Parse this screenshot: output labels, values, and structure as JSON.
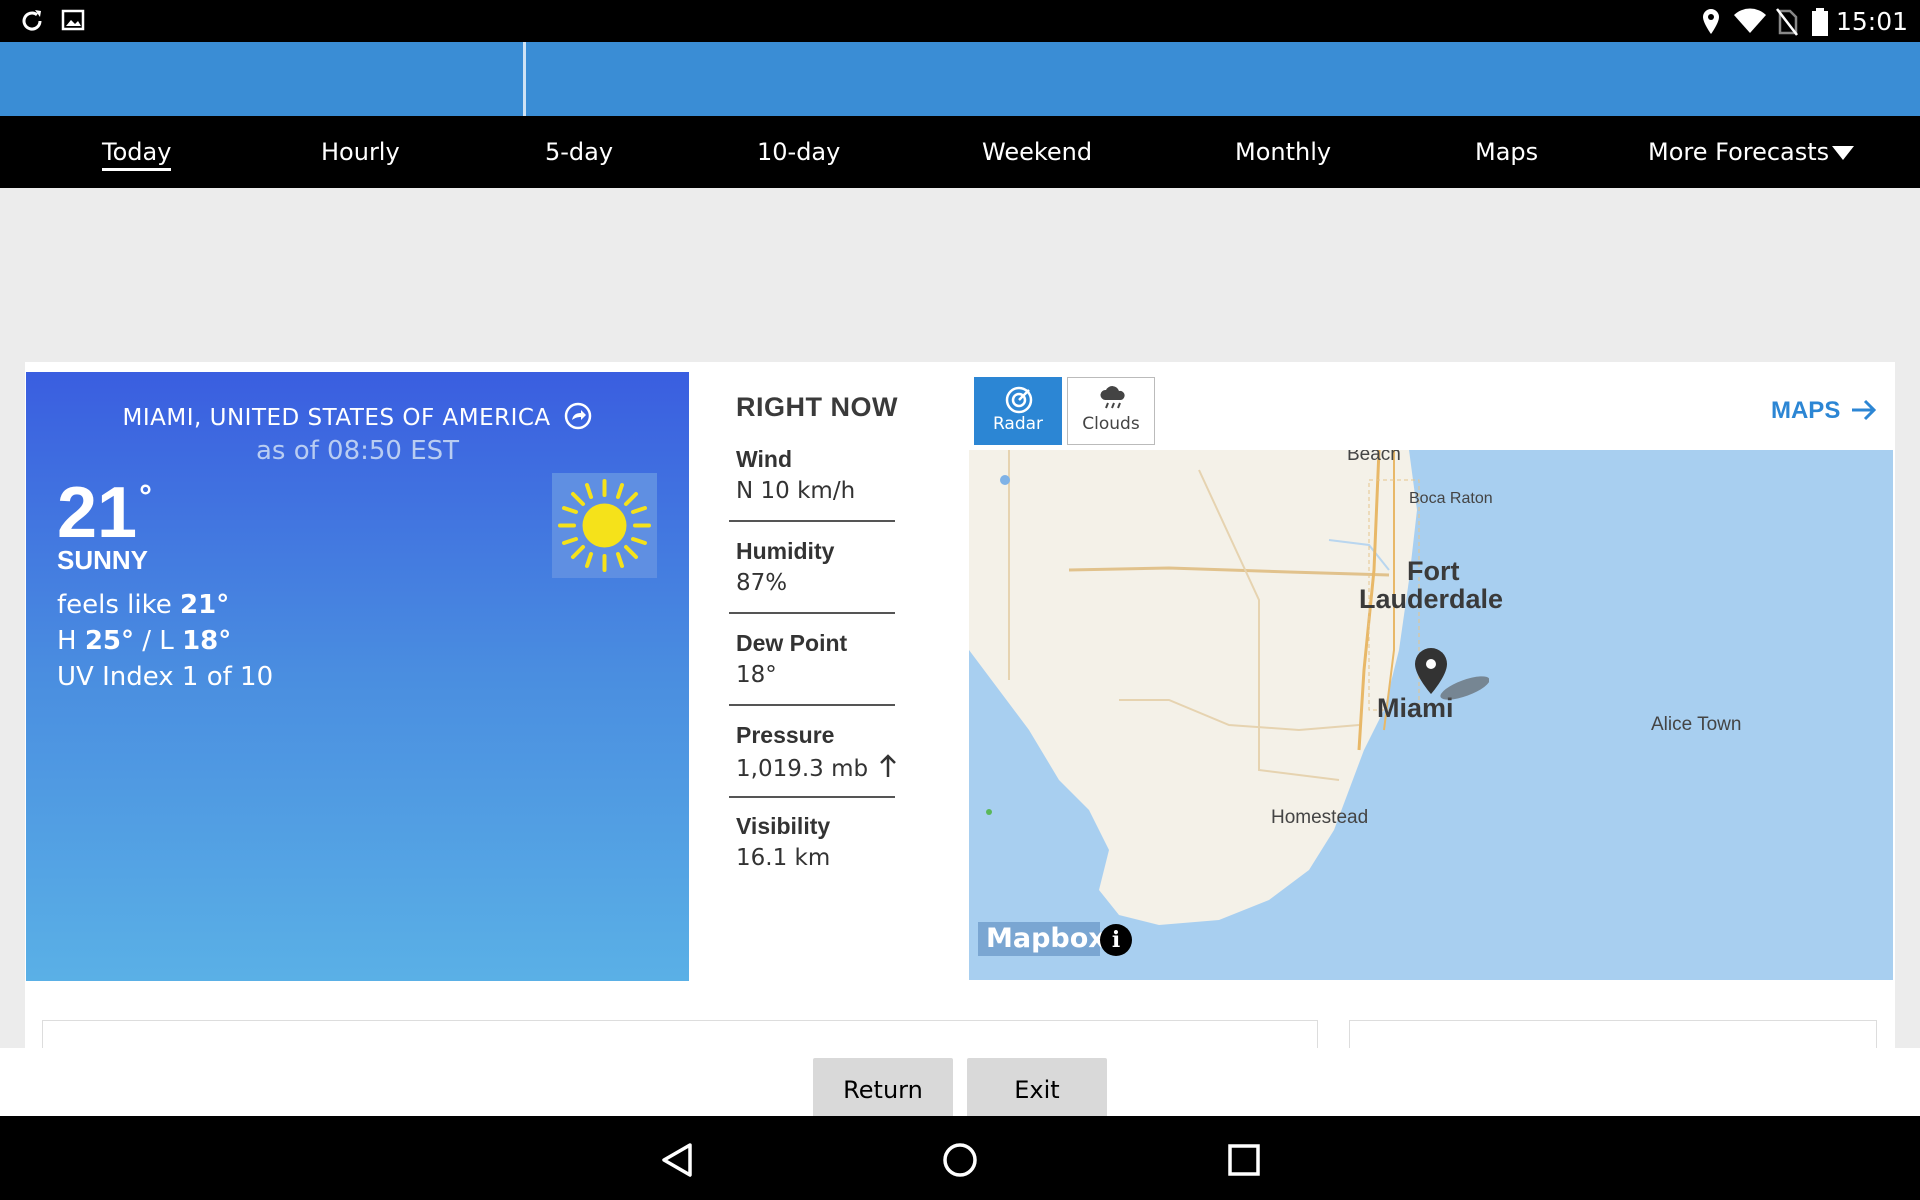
{
  "status_bar": {
    "time": "15:01",
    "icons": [
      "sync-icon",
      "image-icon",
      "location-icon",
      "wifi-icon",
      "no-sim-icon",
      "battery-icon"
    ]
  },
  "nav": {
    "tabs": [
      {
        "label": "Today",
        "active": true
      },
      {
        "label": "Hourly"
      },
      {
        "label": "5-day"
      },
      {
        "label": "10-day"
      },
      {
        "label": "Weekend"
      },
      {
        "label": "Monthly"
      },
      {
        "label": "Maps"
      },
      {
        "label": "More Forecasts"
      }
    ]
  },
  "current": {
    "location": "MIAMI, UNITED STATES OF AMERICA",
    "as_of": "as of 08:50 EST",
    "temp": "21",
    "degree": "°",
    "condition": "SUNNY",
    "feels_like_label": "feels like",
    "feels_like": "21°",
    "high_label": "H",
    "high": "25°",
    "sep": "/ L",
    "low": "18°",
    "uv": "UV Index 1 of 10",
    "icon": "sun-icon"
  },
  "right_now": {
    "title": "RIGHT NOW",
    "items": [
      {
        "label": "Wind",
        "value": "N 10 km/h"
      },
      {
        "label": "Humidity",
        "value": "87%"
      },
      {
        "label": "Dew Point",
        "value": "18°"
      },
      {
        "label": "Pressure",
        "value": "1,019.3 mb"
      },
      {
        "label": "Visibility",
        "value": "16.1 km"
      }
    ]
  },
  "map": {
    "buttons": [
      {
        "label": "Radar",
        "active": true,
        "icon": "radar-icon"
      },
      {
        "label": "Clouds",
        "active": false,
        "icon": "cloud-rain-icon"
      }
    ],
    "maps_link": "MAPS",
    "labels": {
      "beach": "Beach",
      "boca": "Boca Raton",
      "fort1": "Fort",
      "fort2": "Lauderdale",
      "miami": "Miami",
      "alice": "Alice Town",
      "homestead": "Homestead"
    },
    "attribution": "Mapbox",
    "info": "i"
  },
  "dialog": {
    "return_label": "Return",
    "exit_label": "Exit"
  }
}
